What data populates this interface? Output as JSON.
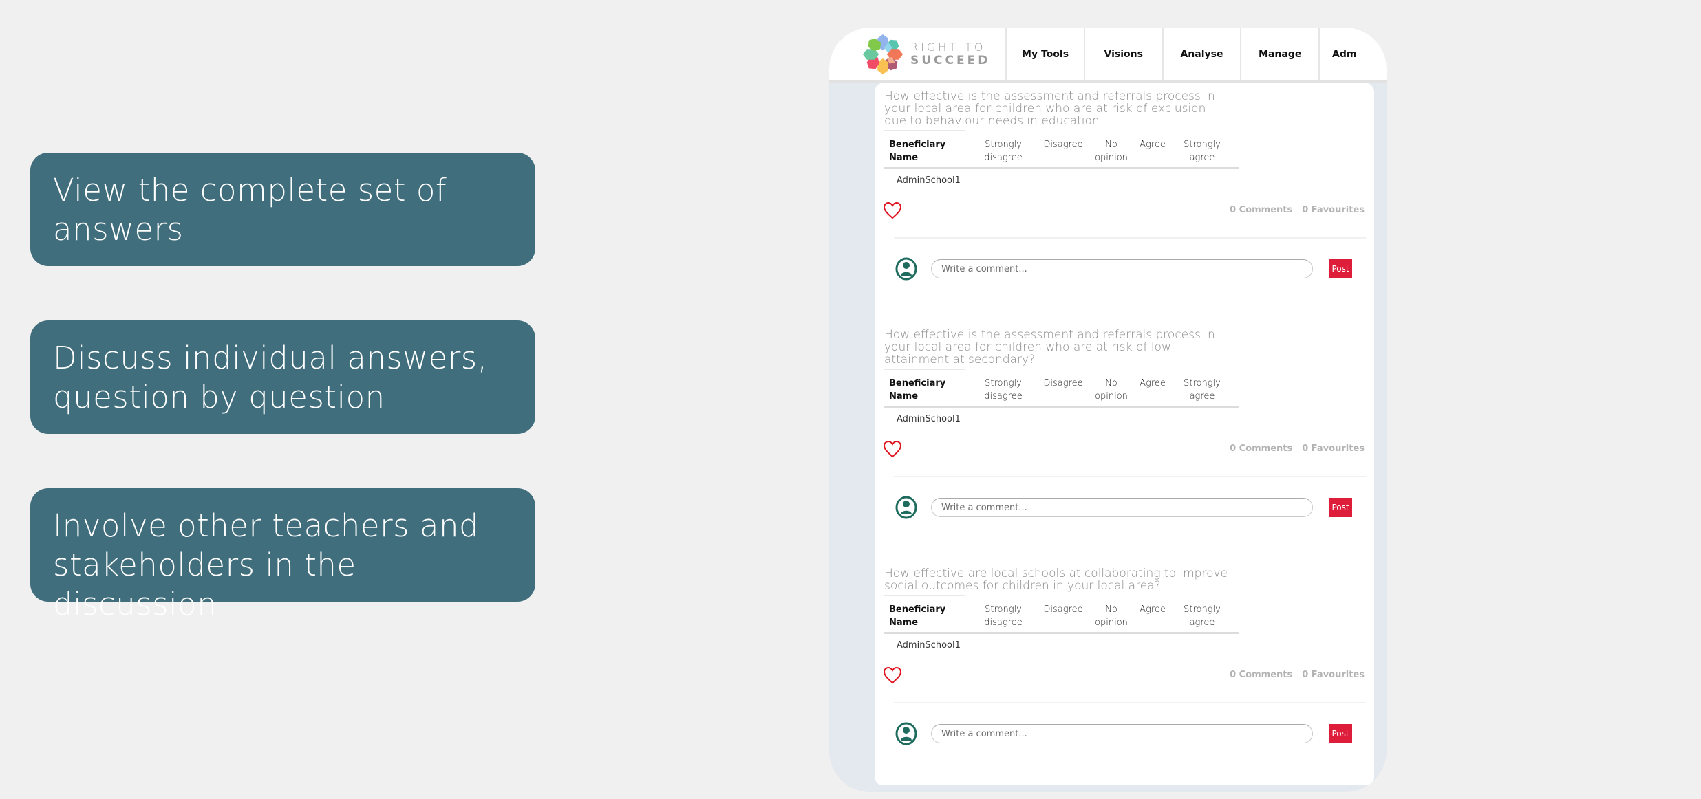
{
  "callouts": [
    "View the complete set of answers",
    "Discuss individual answers, question by question",
    "Involve other teachers and stakeholders in the discussion"
  ],
  "logo": {
    "line1": "RIGHT TO",
    "line2": "SUCCEED"
  },
  "nav": [
    "My Tools",
    "Visions",
    "Analyse",
    "Manage",
    "Adm"
  ],
  "table_headers": {
    "name": "Beneficiary Name",
    "strongly_disagree": "Strongly disagree",
    "disagree": "Disagree",
    "no_opinion": "No opinion",
    "agree": "Agree",
    "strongly_agree": "Strongly agree"
  },
  "questions": [
    {
      "text": "How effective is the assessment and referrals process in your local area for children who are at risk of exclusion due to behaviour needs in education",
      "rows": [
        "AdminSchool1"
      ],
      "comments": "0 Comments",
      "favourites": "0 Favourites"
    },
    {
      "text": "How effective is the assessment and referrals process in your local area for children who are at risk of low attainment at secondary?",
      "rows": [
        "AdminSchool1"
      ],
      "comments": "0 Comments",
      "favourites": "0 Favourites"
    },
    {
      "text": "How effective are local schools at collaborating to improve social outcomes for children in your local area?",
      "rows": [
        "AdminSchool1"
      ],
      "comments": "0 Comments",
      "favourites": "0 Favourites"
    }
  ],
  "comment_box": {
    "placeholder": "Write a comment...",
    "post_label": "Post"
  },
  "colors": {
    "callout_bg": "#416e7c",
    "post_button": "#de1d3a",
    "heart": "#e0141e",
    "avatar": "#1f6b5e"
  }
}
